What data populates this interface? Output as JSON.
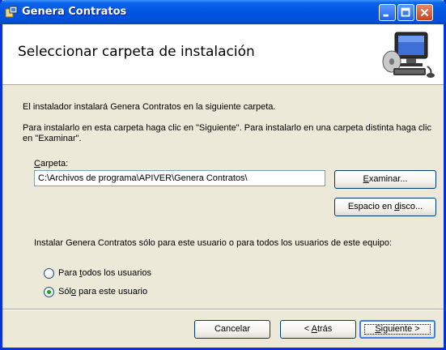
{
  "window": {
    "title": "Genera Contratos",
    "icon": "installer-icon",
    "controls": [
      "minimize-icon",
      "maximize-icon",
      "close-icon"
    ]
  },
  "header": {
    "title": "Seleccionar carpeta de instalación",
    "graphic": "computer-install-graphic"
  },
  "body": {
    "intro_line1": "El instalador instalará Genera Contratos en la siguiente carpeta.",
    "intro_line2": "Para instalarlo en esta carpeta haga clic en \"Siguiente\". Para instalarlo en una carpeta distinta haga clic en \"Examinar\"."
  },
  "folder": {
    "label_before": "",
    "label_mnemonic": "C",
    "label_after": "arpeta:",
    "path_value": "C:\\Archivos de programa\\APIVER\\Genera Contratos\\",
    "browse_before": "",
    "browse_mnemonic": "E",
    "browse_after": "xaminar...",
    "disk_before": "Espacio en ",
    "disk_mnemonic": "d",
    "disk_after": "isco..."
  },
  "scope": {
    "question": "Instalar Genera Contratos sólo para este usuario o para todos los usuarios de este equipo:",
    "options": [
      {
        "before": "Para ",
        "mnemonic": "t",
        "after": "odos los usuarios",
        "selected": false
      },
      {
        "before": "Sól",
        "mnemonic": "o",
        "after": " para este usuario",
        "selected": true
      }
    ]
  },
  "footer": {
    "cancel": "Cancelar",
    "back_before": "< ",
    "back_mnemonic": "A",
    "back_after": "trás",
    "next_before": "",
    "next_mnemonic": "S",
    "next_after": "iguiente >"
  },
  "colors": {
    "titlebar": "#0054e3",
    "dialog_bg": "#ece9d8",
    "radio_selected": "#21a121"
  }
}
